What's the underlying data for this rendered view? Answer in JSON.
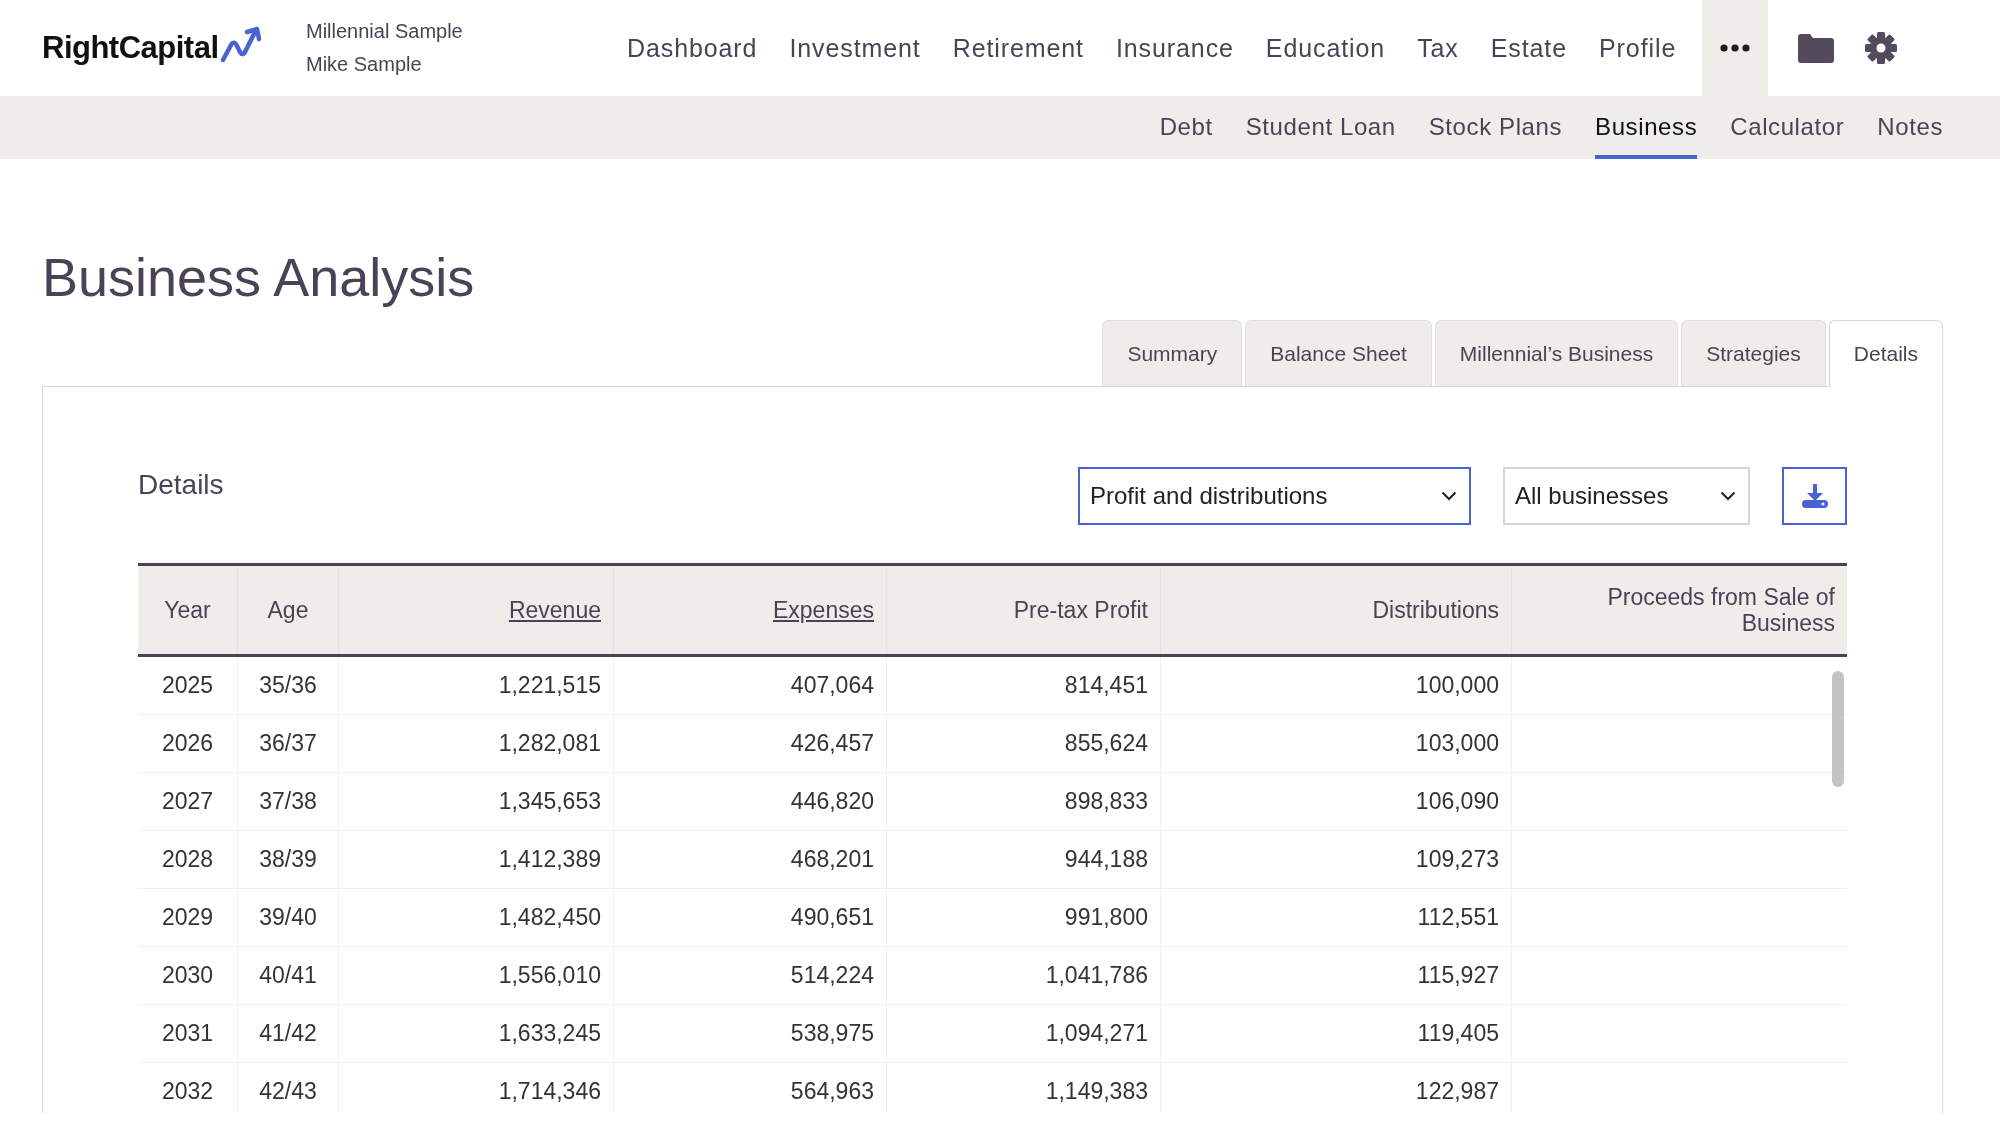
{
  "header": {
    "logo": "RightCapital",
    "client_names": [
      "Millennial Sample",
      "Mike Sample"
    ],
    "nav": [
      {
        "label": "Dashboard"
      },
      {
        "label": "Investment"
      },
      {
        "label": "Retirement"
      },
      {
        "label": "Insurance"
      },
      {
        "label": "Education"
      },
      {
        "label": "Tax"
      },
      {
        "label": "Estate"
      },
      {
        "label": "Profile"
      }
    ]
  },
  "subnav": [
    {
      "label": "Debt",
      "selected": false
    },
    {
      "label": "Student Loan",
      "selected": false
    },
    {
      "label": "Stock Plans",
      "selected": false
    },
    {
      "label": "Business",
      "selected": true
    },
    {
      "label": "Calculator",
      "selected": false
    },
    {
      "label": "Notes",
      "selected": false
    }
  ],
  "page_title": "Business Analysis",
  "tabs": [
    {
      "label": "Summary",
      "selected": false
    },
    {
      "label": "Balance Sheet",
      "selected": false
    },
    {
      "label": "Millennial’s Business",
      "selected": false
    },
    {
      "label": "Strategies",
      "selected": false
    },
    {
      "label": "Details",
      "selected": true
    }
  ],
  "panel": {
    "title": "Details",
    "selects": [
      {
        "value": "Profit and distributions",
        "focused": true
      },
      {
        "value": "All businesses",
        "focused": false
      }
    ],
    "table": {
      "columns": [
        {
          "label": "Year",
          "link": false
        },
        {
          "label": "Age",
          "link": false
        },
        {
          "label": "Revenue",
          "link": true
        },
        {
          "label": "Expenses",
          "link": true
        },
        {
          "label": "Pre-tax Profit",
          "link": false
        },
        {
          "label": "Distributions",
          "link": false
        },
        {
          "label": "Proceeds from Sale of Business",
          "link": false
        }
      ],
      "rows": [
        [
          "2025",
          "35/36",
          "1,221,515",
          "407,064",
          "814,451",
          "100,000"
        ],
        [
          "2026",
          "36/37",
          "1,282,081",
          "426,457",
          "855,624",
          "103,000"
        ],
        [
          "2027",
          "37/38",
          "1,345,653",
          "446,820",
          "898,833",
          "106,090"
        ],
        [
          "2028",
          "38/39",
          "1,412,389",
          "468,201",
          "944,188",
          "109,273"
        ],
        [
          "2029",
          "39/40",
          "1,482,450",
          "490,651",
          "991,800",
          "112,551"
        ],
        [
          "2030",
          "40/41",
          "1,556,010",
          "514,224",
          "1,041,786",
          "115,927"
        ],
        [
          "2031",
          "41/42",
          "1,633,245",
          "538,975",
          "1,094,271",
          "119,405"
        ],
        [
          "2032",
          "42/43",
          "1,714,346",
          "564,963",
          "1,149,383",
          "122,987"
        ]
      ]
    }
  }
}
